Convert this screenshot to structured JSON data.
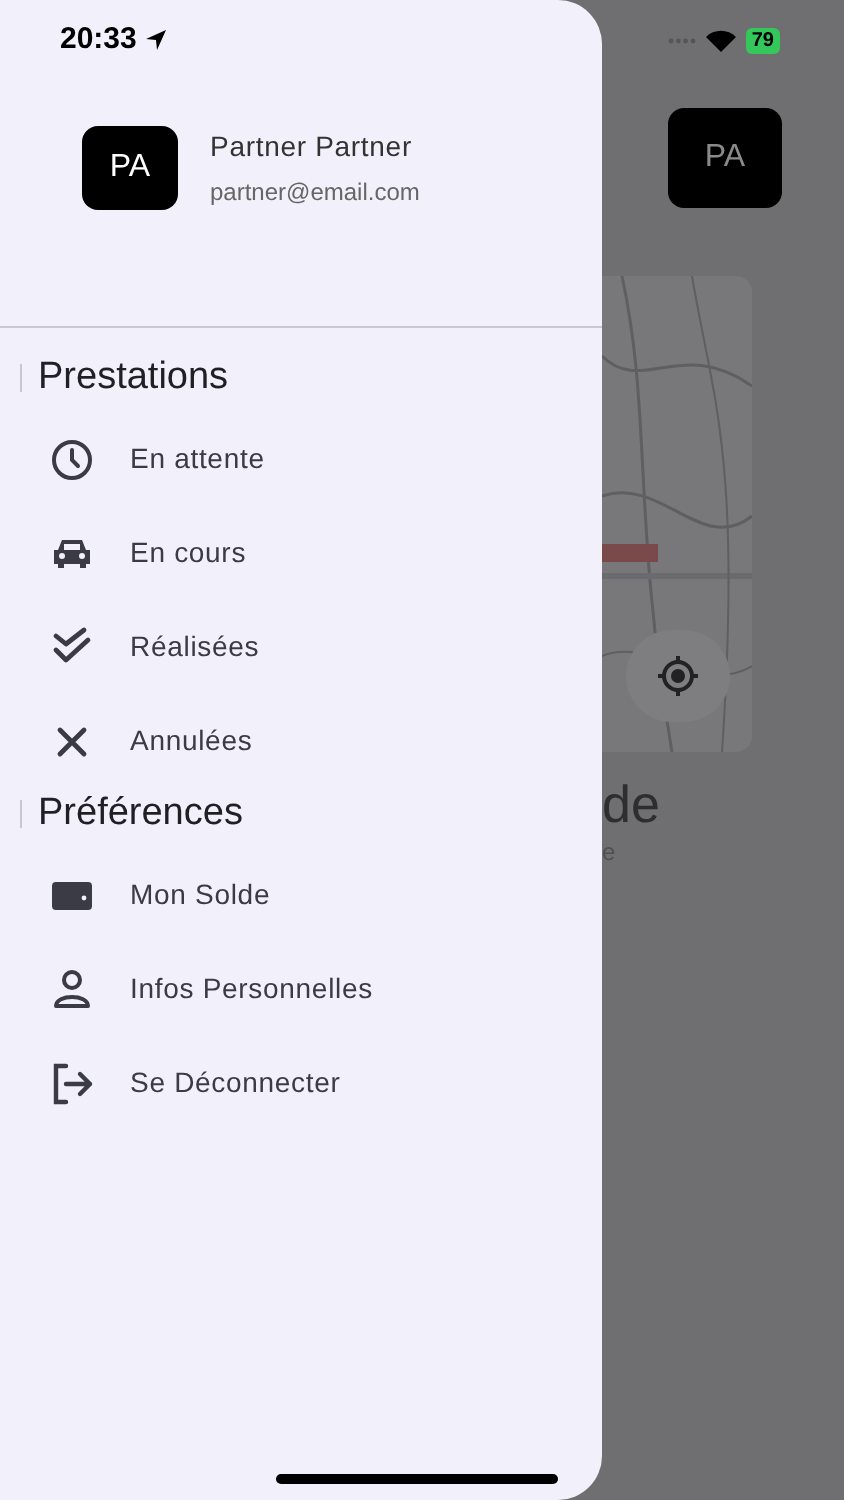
{
  "status_bar": {
    "time": "20:33",
    "battery": "79"
  },
  "drawer": {
    "profile": {
      "initials": "PA",
      "name": "Partner Partner",
      "email": "partner@email.com"
    },
    "sections": [
      {
        "title": "Prestations",
        "items": [
          {
            "label": "En attente"
          },
          {
            "label": "En cours"
          },
          {
            "label": "Réalisées"
          },
          {
            "label": "Annulées"
          }
        ]
      },
      {
        "title": "Préférences",
        "items": [
          {
            "label": "Mon Solde"
          },
          {
            "label": "Infos Personnelles"
          },
          {
            "label": "Se Déconnecter"
          }
        ]
      }
    ]
  },
  "background": {
    "avatar": "PA",
    "title": "de",
    "subtitle": "e"
  }
}
